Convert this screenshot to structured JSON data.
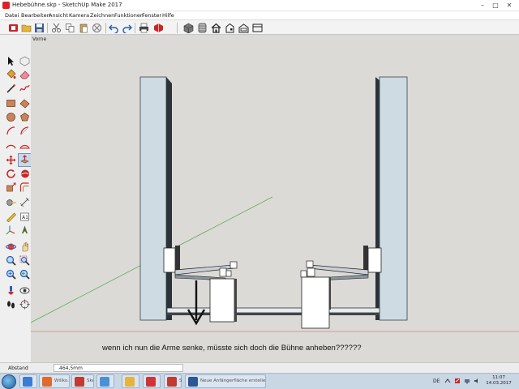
{
  "window": {
    "title": "Hebebühne.skp - SketchUp Make 2017",
    "min_glyph": "–",
    "max_glyph": "□",
    "close_glyph": "✕"
  },
  "menu": [
    "Datei",
    "Bearbeiten",
    "Ansicht",
    "Kamera",
    "Zeichnen",
    "Funktionen",
    "Fenster",
    "Hilfe"
  ],
  "toolbar": {
    "icons": [
      "getting-started-icon",
      "open-icon",
      "save-icon",
      "cut-icon",
      "copy-icon",
      "paste-icon",
      "erase-icon",
      "undo-icon",
      "redo-icon",
      "print-icon",
      "model-info-icon",
      "iso-view-icon",
      "top-view-icon",
      "front-view-icon",
      "right-view-icon",
      "back-view-icon",
      "left-view-icon"
    ]
  },
  "palette": {
    "icons": [
      "select-icon",
      "make-component-icon",
      "paint-bucket-icon",
      "eraser-icon",
      "line-icon",
      "freehand-icon",
      "rectangle-icon",
      "rotated-rectangle-icon",
      "circle-icon",
      "polygon-icon",
      "arc-icon",
      "pie-icon",
      "move-icon",
      "push-pull-icon",
      "rotate-icon",
      "follow-me-icon",
      "scale-icon",
      "offset-icon",
      "tape-measure-icon",
      "dimension-icon",
      "protractor-icon",
      "text-icon",
      "axes-icon",
      "3d-text-icon",
      "orbit-icon",
      "pan-icon",
      "zoom-icon",
      "zoom-window-icon",
      "zoom-extents-icon",
      "previous-view-icon",
      "walk-icon",
      "look-around-icon",
      "position-camera-icon",
      "section-plane-icon"
    ]
  },
  "viewport": {
    "view_label": "Vorne",
    "annotation": "wenn ich nun die Arme senke, müsste sich doch die Bühne anheben??????"
  },
  "statusbar": {
    "label": "Abstand",
    "value": "464,5mm"
  },
  "taskbar": {
    "tasks": [
      {
        "label": "",
        "color": "#3a7bd5"
      },
      {
        "label": "Willko...",
        "color": "#e06a2a"
      },
      {
        "label": "SketchUp...",
        "color": "#c23b30"
      },
      {
        "label": "",
        "color": "#4a90d9"
      },
      {
        "label": "",
        "color": "#e8b33a"
      },
      {
        "label": "",
        "color": "#d13438"
      },
      {
        "label": "Sketc...",
        "color": "#c23b30"
      },
      {
        "label": "Neue Anfängerfläche erstellen.docx",
        "color": "#2b5797"
      }
    ],
    "language": "DE",
    "time": "11:07",
    "date": "14.03.2017"
  },
  "colors": {
    "viewport_bg": "#dcdad6",
    "pillar_face": "#cfdbe2",
    "pillar_side": "#2a3338",
    "green_axis": "#5cae5c",
    "red_axis": "#c98a8a",
    "arrow": "#111111"
  }
}
